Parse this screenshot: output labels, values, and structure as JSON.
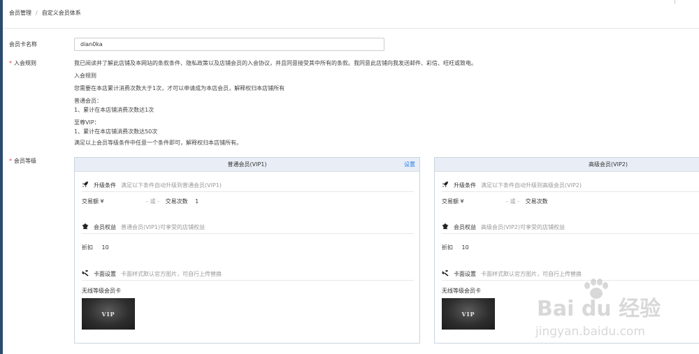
{
  "breadcrumb": {
    "parent": "会员管理",
    "current": "自定义会员体系"
  },
  "form": {
    "card_name_label": "会员卡名称",
    "card_name_value": "dian0ka",
    "rules_label": "入会规则",
    "level_label": "会员等级",
    "required_mark": "*"
  },
  "rules": [
    "我已阅读并了解此店铺及本网站的条款条件、隐私政策以及店铺会员的入会协议，并且同意接受其中所有的条款。我同意此店铺向我发送邮件、彩信、旺旺或致电。",
    "入会规则",
    "您需要在本店累计消费次数大于1次，才可以申请成为本店会员，解释权归本店铺所有",
    "普通会员：",
    "1、累计在本店铺消费次数达1次",
    "至尊VIP：",
    "1、累计在本店铺消费次数达50次",
    "满足以上会员等级条件中任意一个条件即可，解释权归本店铺所有。"
  ],
  "cards": [
    {
      "title": "普通会员(VIP1)",
      "set_link": "设置",
      "upgrade_title": "升级条件",
      "upgrade_desc": "满足以下条件自动升级到普通会员(VIP1)",
      "trade_amount_label": "交易额 ¥",
      "or_text": "- 或 -",
      "trade_count_label": "交易次数",
      "trade_count_value": "1",
      "benefit_title": "会员权益",
      "benefit_desc": "普通会员(VIP1)可享受的店铺权益",
      "discount_label": "折扣",
      "discount_value": "10",
      "card_title": "卡面设置",
      "card_desc": "卡面样式默认官方图片，可自行上传替换",
      "card_name": "无线等级会员卡",
      "vip_text": "VIP"
    },
    {
      "title": "高级会员(VIP2)",
      "set_link": "",
      "upgrade_title": "升级条件",
      "upgrade_desc": "满足以下条件自动升级到高级会员(VIP2)",
      "trade_amount_label": "交易额 ¥",
      "or_text": "- 或 -",
      "trade_count_label": "交易次数",
      "trade_count_value": "",
      "benefit_title": "会员权益",
      "benefit_desc": "高级会员(VIP2)可享受的店铺权益",
      "discount_label": "折扣",
      "discount_value": "10",
      "card_title": "卡面设置",
      "card_desc": "卡面样式默认官方图片，可自行上传替换",
      "card_name": "无线等级会员卡",
      "vip_text": "VIP"
    }
  ],
  "watermark": {
    "logo": "Bai du 经验",
    "url": "jingyan.baidu.com"
  },
  "icons": {
    "upgrade": "rocket-icon",
    "benefit": "crown-icon",
    "card": "tools-icon"
  },
  "colors": {
    "accent": "#2c7be5",
    "required": "#e4393c",
    "card_head_bg": "#e9eef6"
  }
}
